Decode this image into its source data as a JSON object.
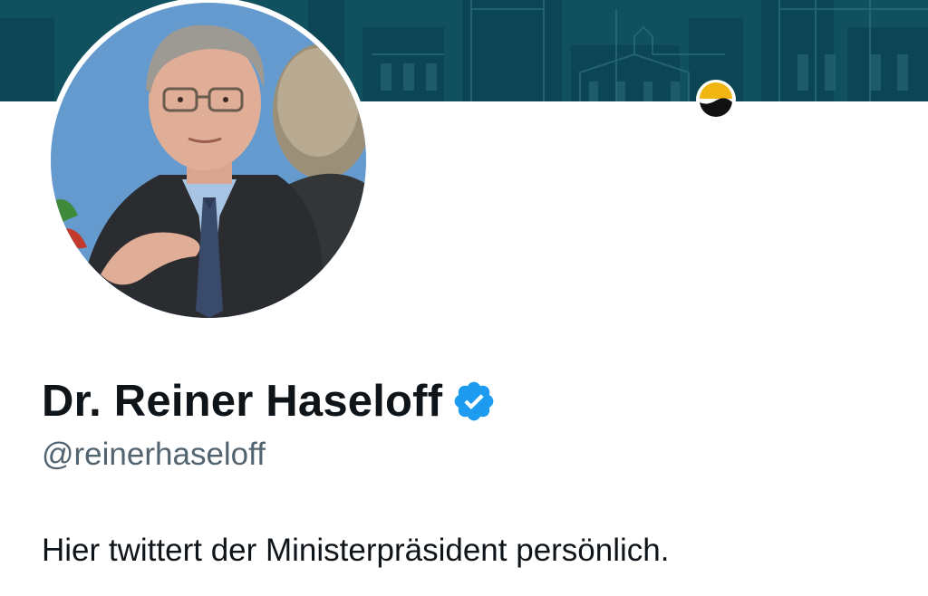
{
  "profile": {
    "display_name": "Dr. Reiner Haseloff",
    "handle": "@reinerhaseloff",
    "bio": "Hier twittert der Ministerpräsident persönlich.",
    "verified": true
  },
  "icons": {
    "verified_badge": "verified-badge-icon",
    "overlay_badge": "sun-mountain-badge-icon"
  },
  "colors": {
    "banner": "#0f4d5c",
    "verified": "#1d9bf0",
    "name": "#0f1419",
    "handle": "#536471"
  }
}
